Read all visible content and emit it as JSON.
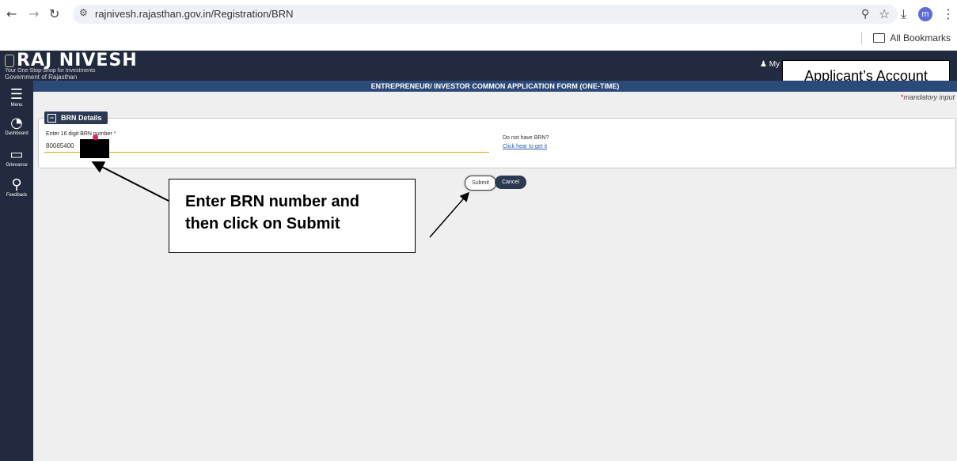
{
  "browser": {
    "url": "rajnivesh.rajasthan.gov.in/Registration/BRN",
    "profile_initial": "m",
    "bookmarks_label": "All Bookmarks"
  },
  "header": {
    "logo_title": "RAJ NIVESH",
    "logo_tagline": "Your One-Stop-Shop for Investments",
    "logo_gov": "Government of Rajasthan",
    "profile_label": "My Pr"
  },
  "callouts": {
    "account": "Applicant’s Account",
    "instruction_line1": "Enter BRN number and",
    "instruction_line2": "then click on Submit"
  },
  "form": {
    "title": "ENTREPRENEUR/ INVESTOR COMMON APPLICATION FORM (ONE-TIME)",
    "mandatory_note": "mandatory input",
    "section_title": "BRN Details",
    "brn_label": "Enter 16 digit BRN number",
    "brn_value": "80065400",
    "no_brn_text": "Do not have BRN?",
    "get_brn_link": "Click hear to get it",
    "submit_label": "Submit",
    "cancel_label": "Cancel"
  },
  "sidebar": {
    "items": [
      {
        "label": "Menu",
        "icon": "menu-icon"
      },
      {
        "label": "Dashboard",
        "icon": "dashboard-icon"
      },
      {
        "label": "Grievance",
        "icon": "grievance-icon"
      },
      {
        "label": "Feedback",
        "icon": "feedback-icon"
      }
    ]
  },
  "colors": {
    "header_bg": "#212a3e",
    "title_bar_bg": "#2b4a78",
    "underline": "#e0a800",
    "required_star": "#d0021b"
  }
}
